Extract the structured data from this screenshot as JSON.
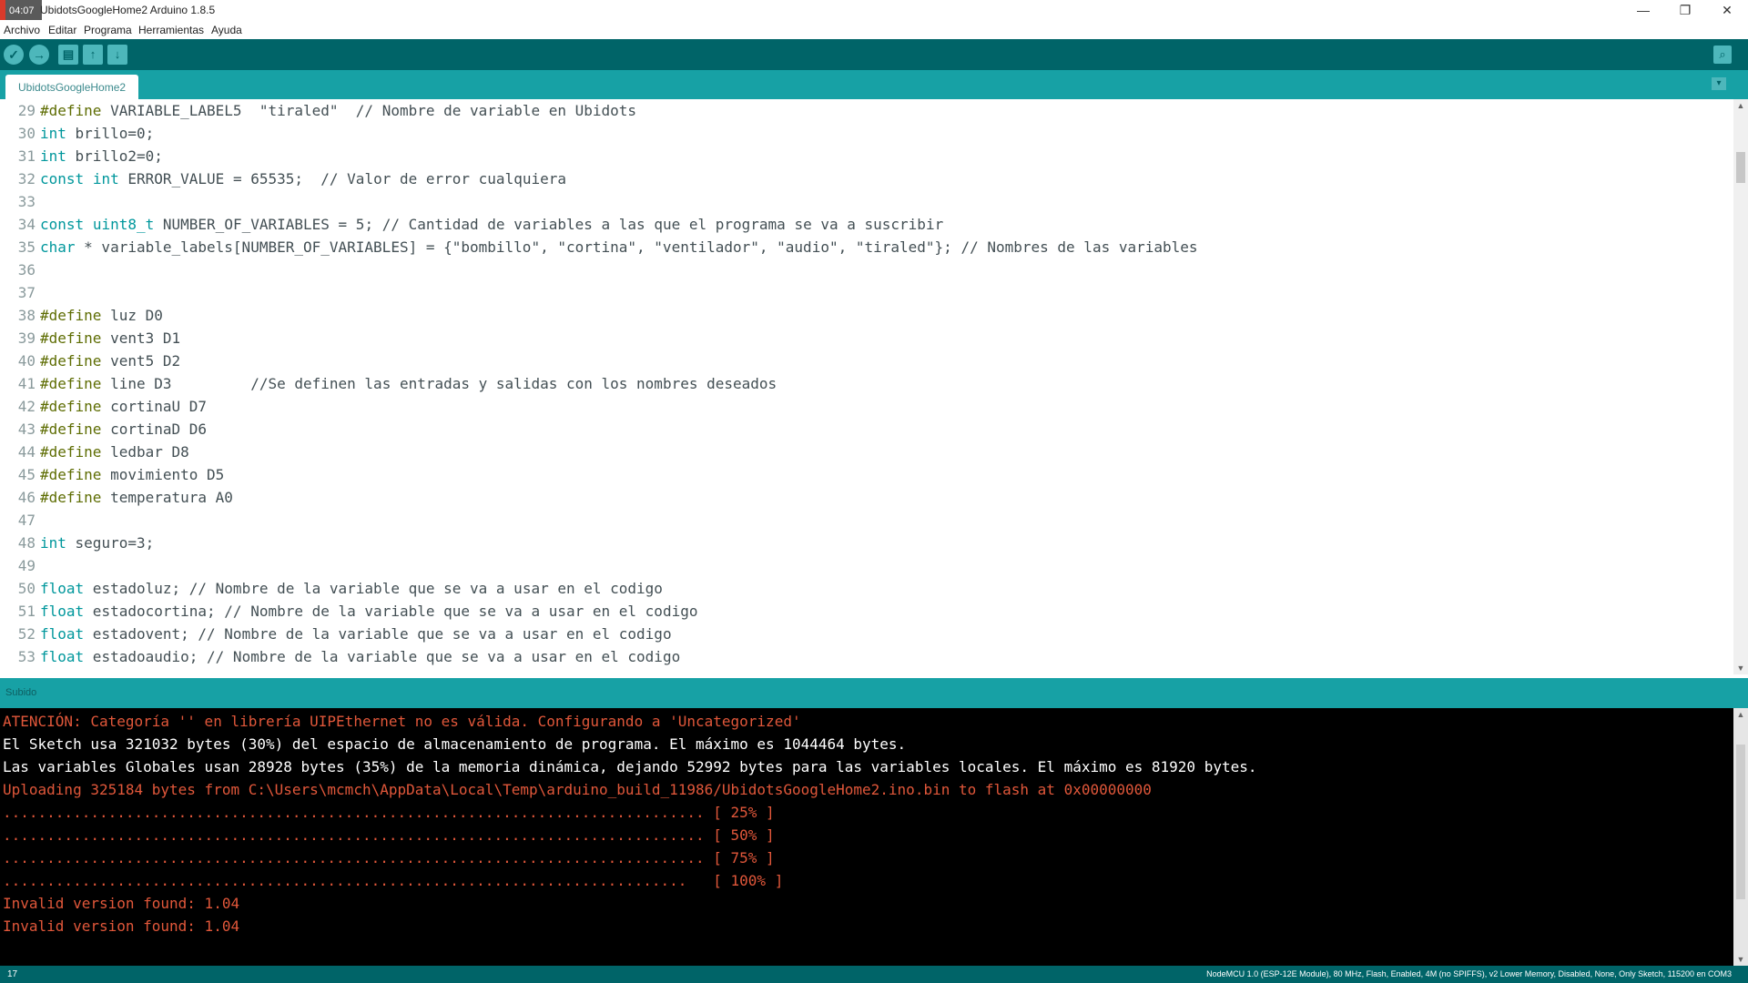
{
  "window": {
    "time": "04:07",
    "title": "UbidotsGoogleHome2 Arduino 1.8.5",
    "minimize": "—",
    "maximize": "❐",
    "close": "✕"
  },
  "menu": [
    "Archivo",
    "Editar",
    "Programa",
    "Herramientas",
    "Ayuda"
  ],
  "toolbar": {
    "verify": "✓",
    "upload": "→",
    "new": "▤",
    "open": "↑",
    "save": "↓",
    "serial_monitor": "⌕"
  },
  "tab": {
    "name": "UbidotsGoogleHome2",
    "menu": "▾"
  },
  "editor": {
    "lines": [
      {
        "n": "29",
        "parts": [
          {
            "t": "#define",
            "c": "pp"
          },
          {
            "t": " VARIABLE_LABEL5  \"tiraled\"  // Nombre de variable en Ubidots"
          }
        ]
      },
      {
        "n": "30",
        "parts": [
          {
            "t": "int",
            "c": "kw"
          },
          {
            "t": " brillo=0;"
          }
        ]
      },
      {
        "n": "31",
        "parts": [
          {
            "t": "int",
            "c": "kw"
          },
          {
            "t": " brillo2=0;"
          }
        ]
      },
      {
        "n": "32",
        "parts": [
          {
            "t": "const",
            "c": "kw"
          },
          {
            "t": " "
          },
          {
            "t": "int",
            "c": "kw"
          },
          {
            "t": " ERROR_VALUE = 65535;  // Valor de error cualquiera"
          }
        ]
      },
      {
        "n": "33",
        "parts": []
      },
      {
        "n": "34",
        "parts": [
          {
            "t": "const",
            "c": "kw"
          },
          {
            "t": " "
          },
          {
            "t": "uint8_t",
            "c": "kw"
          },
          {
            "t": " NUMBER_OF_VARIABLES = 5; // Cantidad de variables a las que el programa se va a suscribir"
          }
        ]
      },
      {
        "n": "35",
        "parts": [
          {
            "t": "char",
            "c": "kw"
          },
          {
            "t": " * variable_labels[NUMBER_OF_VARIABLES] = {\"bombillo\", \"cortina\", \"ventilador\", \"audio\", \"tiraled\"}; // Nombres de las variables"
          }
        ]
      },
      {
        "n": "36",
        "parts": []
      },
      {
        "n": "37",
        "parts": []
      },
      {
        "n": "38",
        "parts": [
          {
            "t": "#define",
            "c": "pp"
          },
          {
            "t": " luz D0"
          }
        ]
      },
      {
        "n": "39",
        "parts": [
          {
            "t": "#define",
            "c": "pp"
          },
          {
            "t": " vent3 D1"
          }
        ]
      },
      {
        "n": "40",
        "parts": [
          {
            "t": "#define",
            "c": "pp"
          },
          {
            "t": " vent5 D2"
          }
        ]
      },
      {
        "n": "41",
        "parts": [
          {
            "t": "#define",
            "c": "pp"
          },
          {
            "t": " line D3         //Se definen las entradas y salidas con los nombres deseados"
          }
        ]
      },
      {
        "n": "42",
        "parts": [
          {
            "t": "#define",
            "c": "pp"
          },
          {
            "t": " cortinaU D7"
          }
        ]
      },
      {
        "n": "43",
        "parts": [
          {
            "t": "#define",
            "c": "pp"
          },
          {
            "t": " cortinaD D6"
          }
        ]
      },
      {
        "n": "44",
        "parts": [
          {
            "t": "#define",
            "c": "pp"
          },
          {
            "t": " ledbar D8"
          }
        ]
      },
      {
        "n": "45",
        "parts": [
          {
            "t": "#define",
            "c": "pp"
          },
          {
            "t": " movimiento D5"
          }
        ]
      },
      {
        "n": "46",
        "parts": [
          {
            "t": "#define",
            "c": "pp"
          },
          {
            "t": " temperatura A0"
          }
        ]
      },
      {
        "n": "47",
        "parts": []
      },
      {
        "n": "48",
        "parts": [
          {
            "t": "int",
            "c": "kw"
          },
          {
            "t": " seguro=3;"
          }
        ]
      },
      {
        "n": "49",
        "parts": []
      },
      {
        "n": "50",
        "parts": [
          {
            "t": "float",
            "c": "kw"
          },
          {
            "t": " estadoluz; // Nombre de la variable que se va a usar en el codigo"
          }
        ]
      },
      {
        "n": "51",
        "parts": [
          {
            "t": "float",
            "c": "kw"
          },
          {
            "t": " estadocortina; // Nombre de la variable que se va a usar en el codigo"
          }
        ]
      },
      {
        "n": "52",
        "parts": [
          {
            "t": "float",
            "c": "kw"
          },
          {
            "t": " estadovent; // Nombre de la variable que se va a usar en el codigo"
          }
        ]
      },
      {
        "n": "53",
        "parts": [
          {
            "t": "float",
            "c": "kw"
          },
          {
            "t": " estadoaudio; // Nombre de la variable que se va a usar en el codigo"
          }
        ]
      }
    ]
  },
  "status": {
    "text": "Subido"
  },
  "console": {
    "lines": [
      {
        "t": "ATENCIÓN: Categoría '' en librería UIPEthernet no es válida. Configurando a 'Uncategorized'",
        "c": "orange"
      },
      {
        "t": "El Sketch usa 321032 bytes (30%) del espacio de almacenamiento de programa. El máximo es 1044464 bytes.",
        "c": "white"
      },
      {
        "t": "Las variables Globales usan 28928 bytes (35%) de la memoria dinámica, dejando 52992 bytes para las variables locales. El máximo es 81920 bytes.",
        "c": "white"
      },
      {
        "t": "Uploading 325184 bytes from C:\\Users\\mcmch\\AppData\\Local\\Temp\\arduino_build_11986/UbidotsGoogleHome2.ino.bin to flash at 0x00000000",
        "c": "orange"
      },
      {
        "t": "................................................................................ [ 25% ]",
        "c": "orange"
      },
      {
        "t": "................................................................................ [ 50% ]",
        "c": "orange"
      },
      {
        "t": "................................................................................ [ 75% ]",
        "c": "orange"
      },
      {
        "t": "..............................................................................   [ 100% ]",
        "c": "orange"
      },
      {
        "t": "Invalid version found: 1.04",
        "c": "orange"
      },
      {
        "t": "Invalid version found: 1.04",
        "c": "orange"
      }
    ]
  },
  "bottom": {
    "line_number": "17",
    "board": "NodeMCU 1.0 (ESP-12E Module), 80 MHz, Flash, Enabled, 4M (no SPIFFS), v2 Lower Memory, Disabled, None, Only Sketch, 115200 en COM3"
  }
}
